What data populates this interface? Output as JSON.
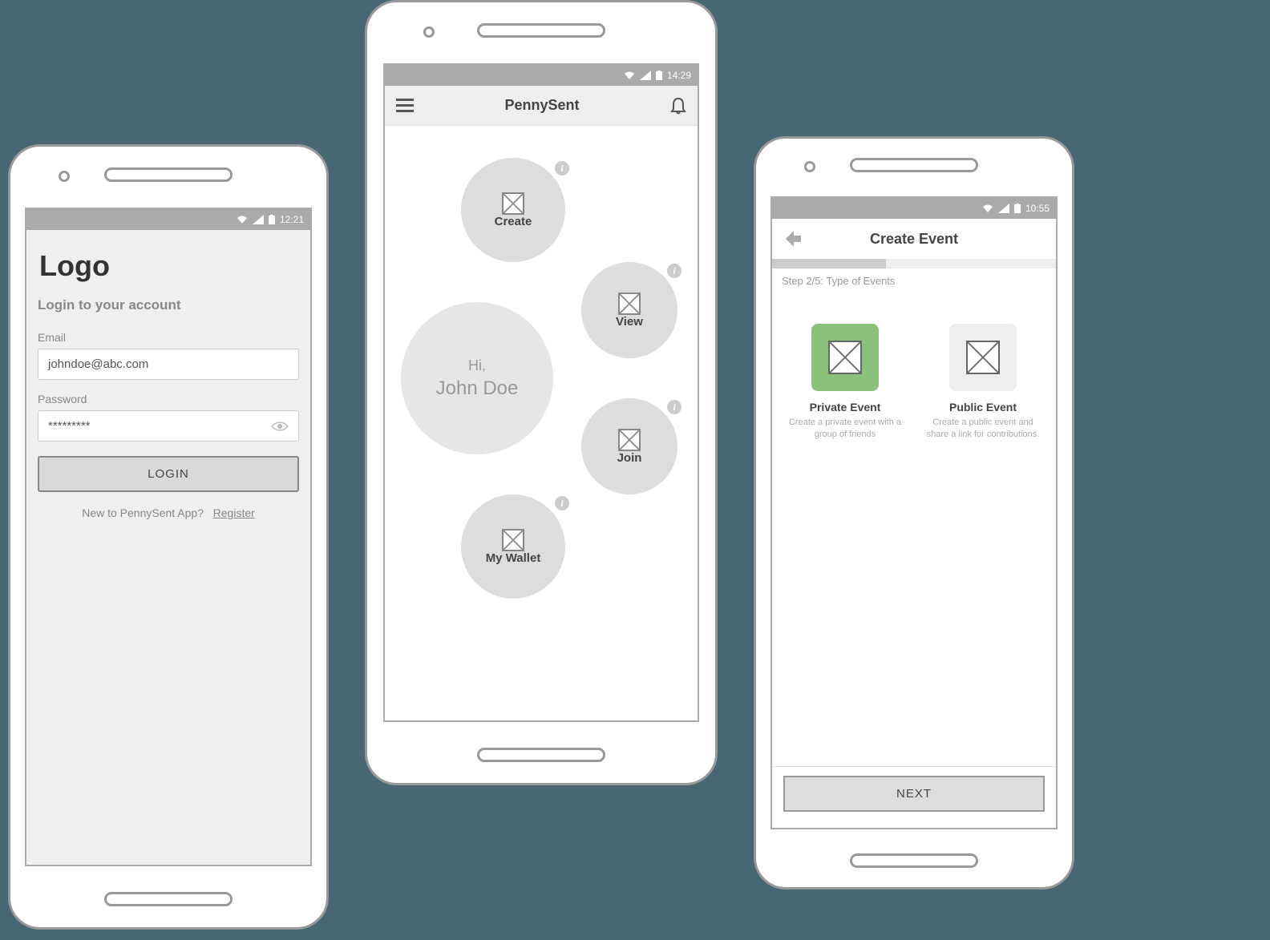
{
  "screens": {
    "login": {
      "status_time": "12:21",
      "logo": "Logo",
      "subtitle": "Login to your account",
      "email_label": "Email",
      "email_value": "johndoe@abc.com",
      "password_label": "Password",
      "password_value": "*********",
      "login_button": "LOGIN",
      "register_prompt": "New to PennySent App?",
      "register_link": "Register"
    },
    "home": {
      "status_time": "14:29",
      "app_title": "PennySent",
      "greeting_hi": "Hi,",
      "greeting_name": "John Doe",
      "bubbles": {
        "create": "Create",
        "view": "View",
        "join": "Join",
        "wallet": "My Wallet"
      }
    },
    "create_event": {
      "status_time": "10:55",
      "title": "Create Event",
      "step_label": "Step 2/5: Type of Events",
      "progress_percent": 40,
      "private": {
        "title": "Private Event",
        "desc": "Create a private event with a group of friends"
      },
      "public": {
        "title": "Public Event",
        "desc": "Create a public event and share a link for contributions."
      },
      "next_button": "NEXT"
    }
  },
  "colors": {
    "selected_tile": "#8bc17a"
  }
}
